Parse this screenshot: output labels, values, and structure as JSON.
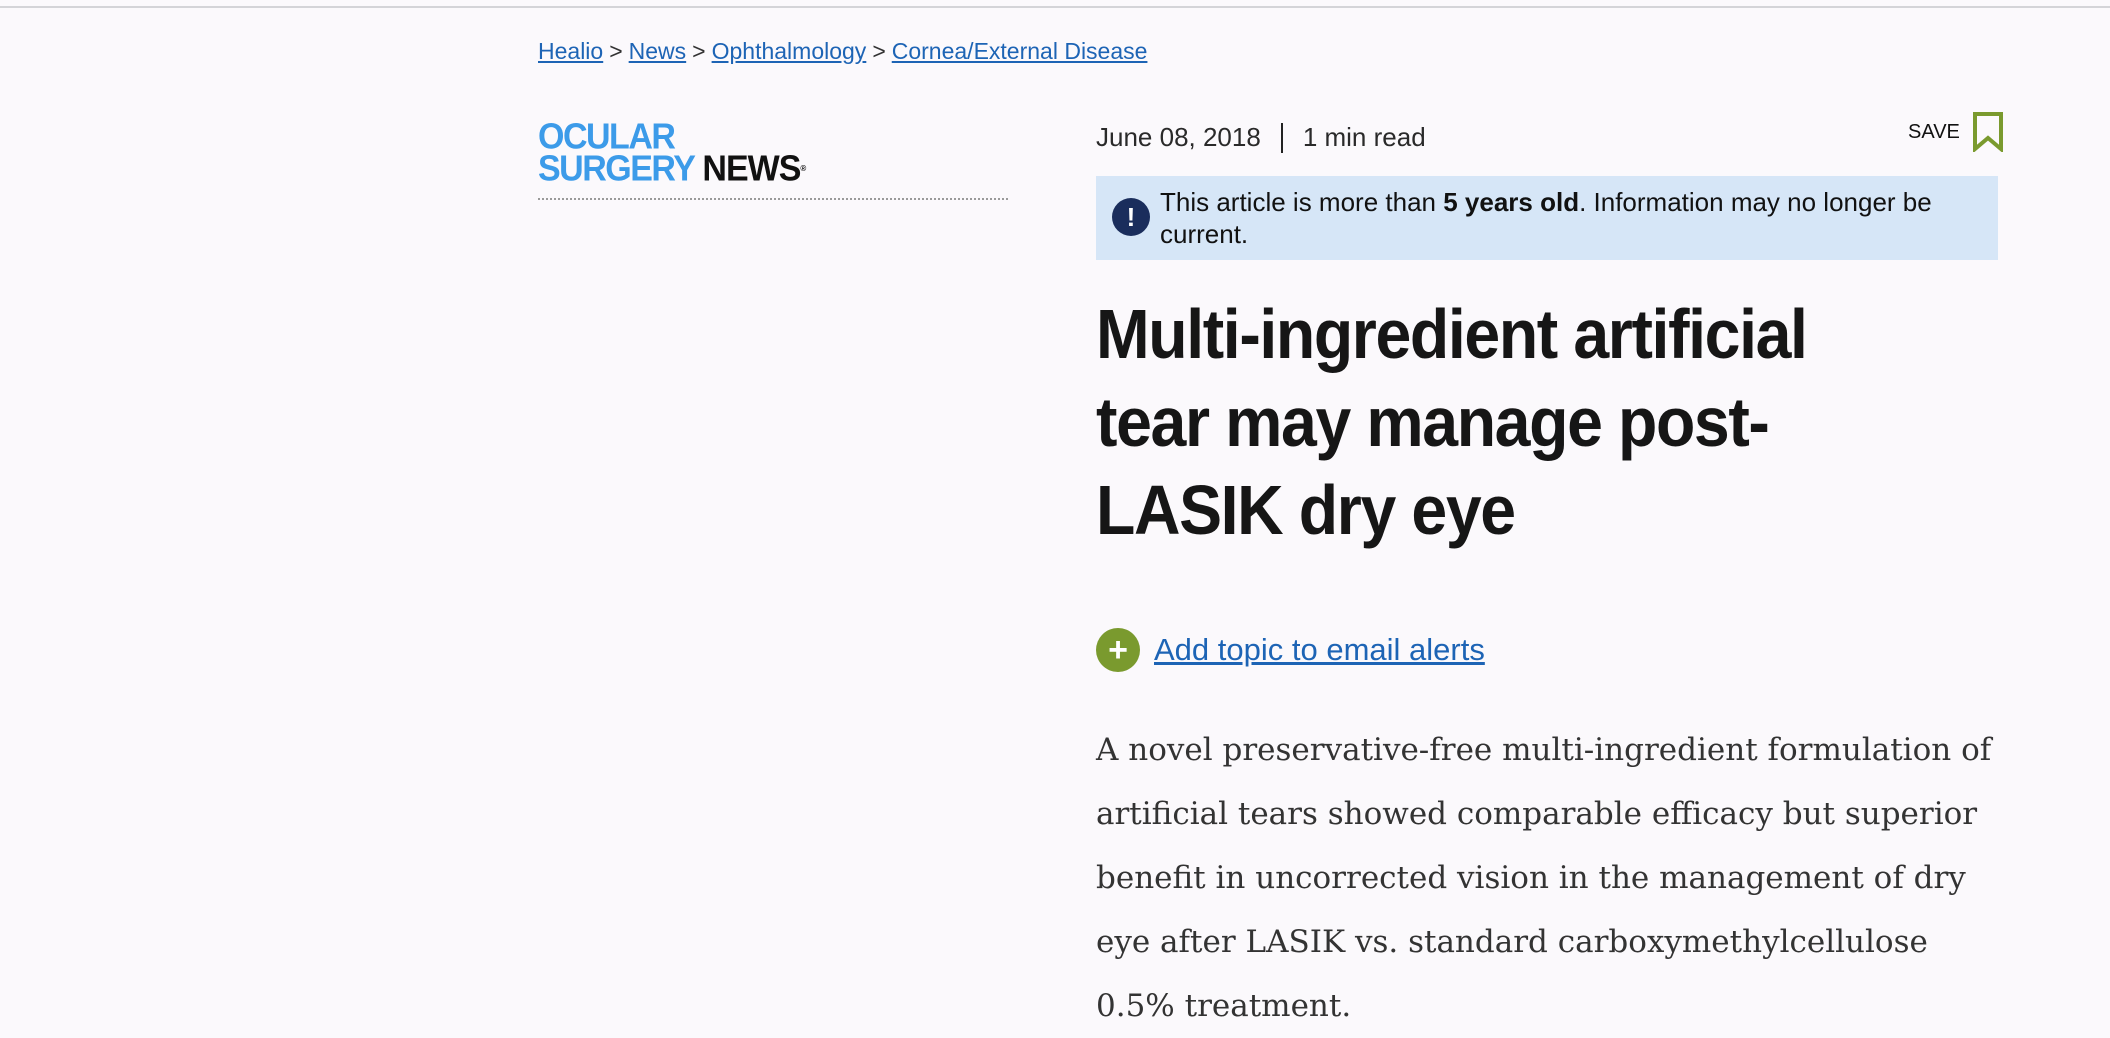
{
  "breadcrumb": {
    "items": [
      "Healio",
      "News",
      "Ophthalmology",
      "Cornea/External Disease"
    ],
    "separator": ">"
  },
  "logo": {
    "line1": "OCULAR",
    "line2": "SURGERY",
    "line3": "NEWS",
    "mark": "®",
    "brand_color": "#3c9be9"
  },
  "article": {
    "date": "June 08, 2018",
    "read_time": "1 min read",
    "save_label": "SAVE",
    "notice_prefix": "This article is more than ",
    "notice_bold": "5 years old",
    "notice_suffix": ". Information may no longer be current.",
    "title": "Multi-ingredient artificial tear may manage post-LASIK dry eye",
    "alerts_label": "Add topic to email alerts",
    "lead": "A novel preservative-free multi-ingredient formulation of artificial tears showed comparable efficacy but superior benefit in uncorrected vision in the management of dry eye after LASIK vs. standard carboxymethylcellulose 0.5% treatment."
  },
  "icons": {
    "save": "bookmark-icon",
    "notice": "exclamation-icon",
    "alerts": "plus-circle-icon"
  },
  "colors": {
    "link": "#1d64b5",
    "notice_bg": "#d6e6f7",
    "accent_green": "#7a9a2e",
    "notice_icon": "#1a2d5c"
  }
}
